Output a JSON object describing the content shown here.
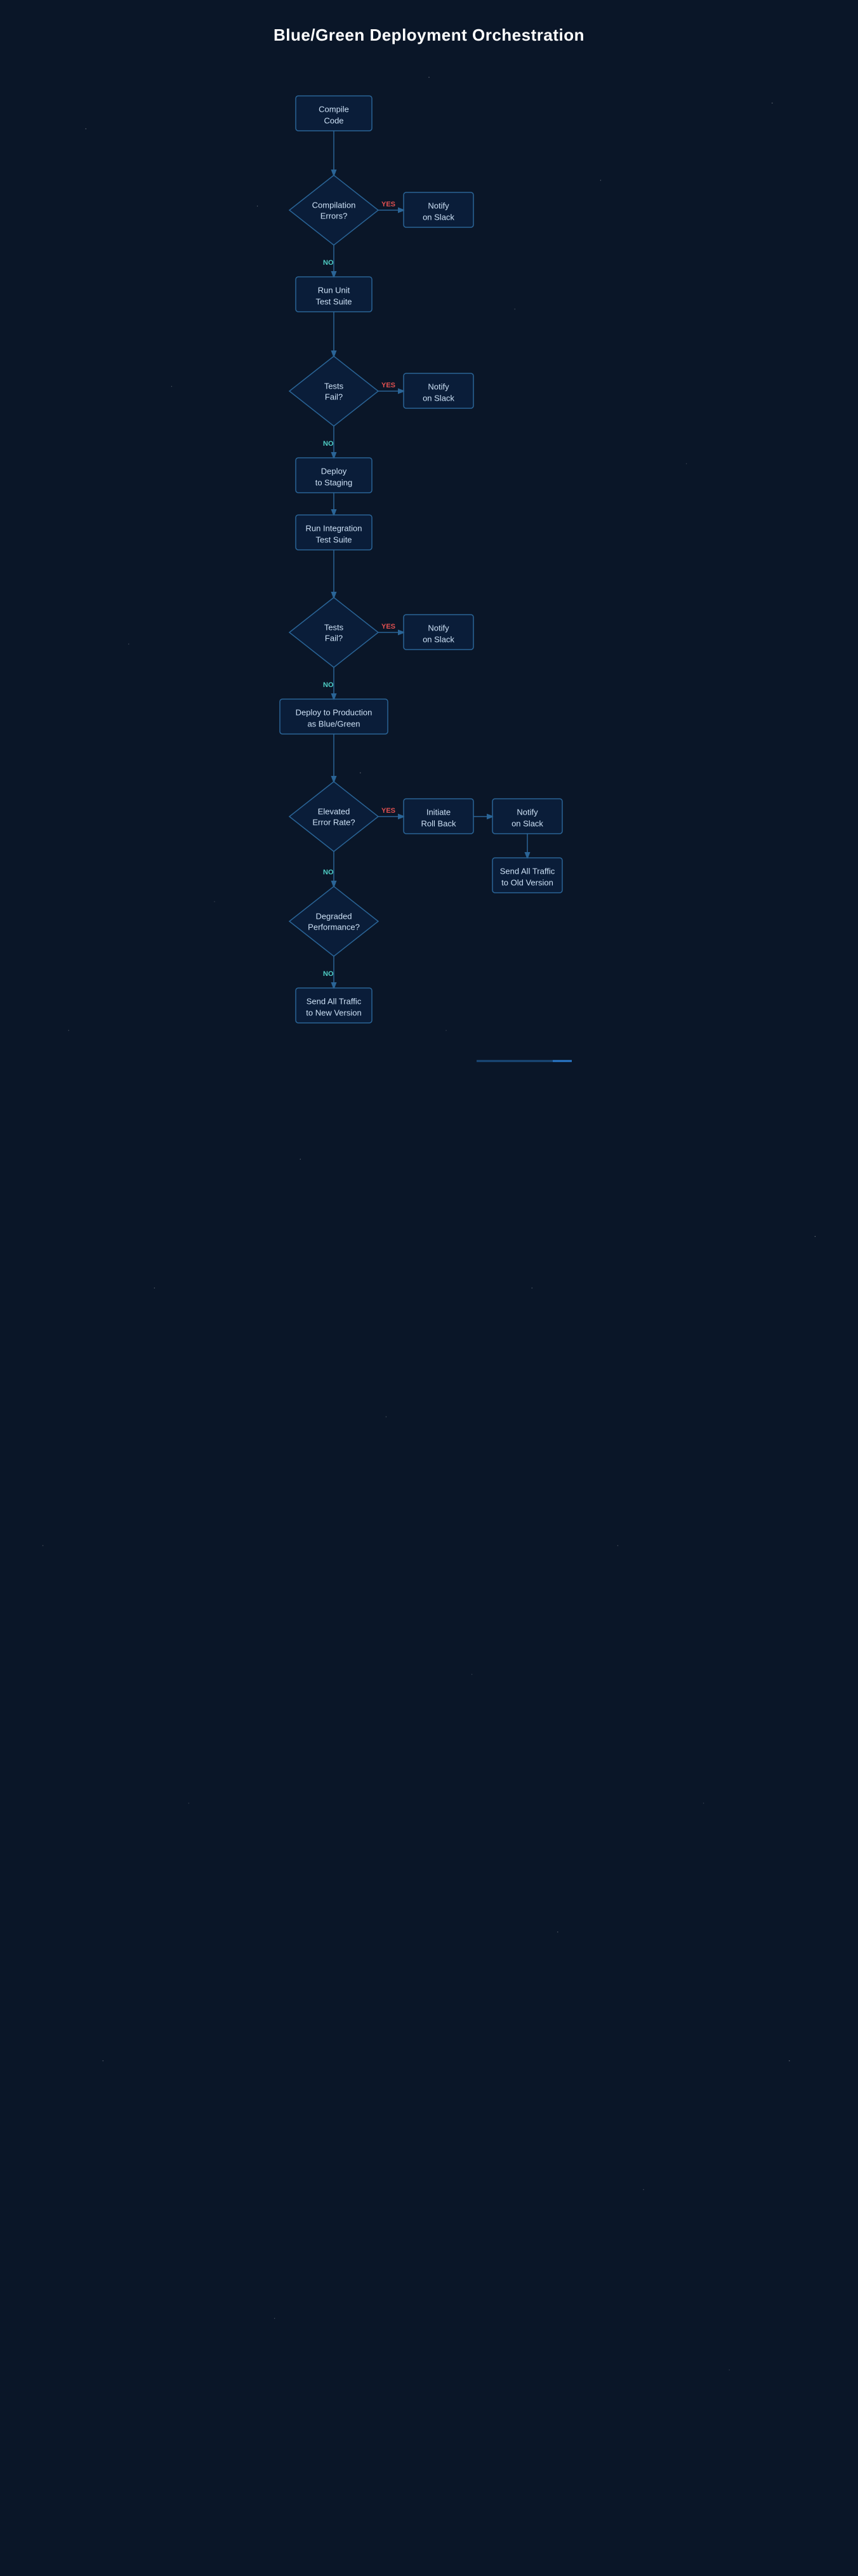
{
  "page": {
    "title": "Blue/Green Deployment Orchestration",
    "background_color": "#0a1628"
  },
  "nodes": {
    "compile_code": "Compile\nCode",
    "compilation_errors": "Compilation\nErrors?",
    "notify_slack_1": "Notify\non Slack",
    "run_unit_test": "Run Unit\nTest Suite",
    "tests_fail_1": "Tests\nFail?",
    "notify_slack_2": "Notify\non Slack",
    "deploy_staging": "Deploy\nto Staging",
    "run_integration_test": "Run Integration\nTest Suite",
    "tests_fail_2": "Tests\nFail?",
    "notify_slack_3": "Notify\non Slack",
    "deploy_production": "Deploy to Production\nas Blue/Green",
    "elevated_error_rate": "Elevated\nError Rate?",
    "initiate_rollback": "Initiate\nRoll Back",
    "notify_slack_4": "Notify\non Slack",
    "send_traffic_old": "Send All Traffic\nto Old Version",
    "degraded_performance": "Degraded\nPerformance?",
    "send_traffic_new": "Send All Traffic\nto New Version"
  },
  "labels": {
    "yes": "YES",
    "no": "NO"
  },
  "accent_colors": {
    "yes": "#e05050",
    "no": "#4ecdc4",
    "connector": "#2a6496",
    "node_stroke": "#2a6496",
    "node_fill": "rgba(10,30,60,0.85)",
    "text": "#cce0f5"
  }
}
